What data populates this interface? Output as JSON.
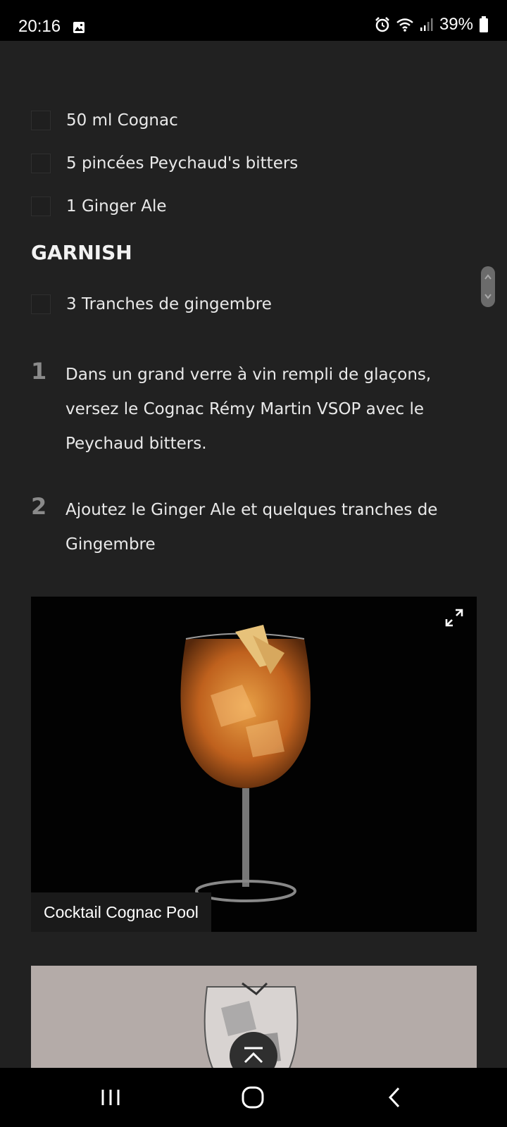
{
  "status_bar": {
    "time": "20:16",
    "battery": "39%",
    "icons": [
      "image-icon",
      "alarm-icon",
      "wifi-icon",
      "signal-icon",
      "battery-icon"
    ]
  },
  "ingredients": [
    {
      "label": "50 ml Cognac"
    },
    {
      "label": "5 pincées Peychaud's bitters"
    },
    {
      "label": "1 Ginger Ale"
    }
  ],
  "garnish": {
    "title": "GARNISH",
    "items": [
      {
        "label": "3 Tranches de gingembre"
      }
    ]
  },
  "steps": [
    {
      "number": "1",
      "text": "Dans un grand verre à vin rempli de glaçons, versez le Cognac Rémy Martin VSOP avec le Peychaud bitters."
    },
    {
      "number": "2",
      "text": "Ajoutez le Ginger Ale et quelques tranches de Gingembre"
    }
  ],
  "image": {
    "caption": "Cocktail Cognac Pool"
  },
  "colors": {
    "background": "#212121",
    "text": "#e6e6e6",
    "step_number": "#8a8a8a",
    "image_bg": "#020202",
    "second_image_bg": "#b4aba8"
  }
}
